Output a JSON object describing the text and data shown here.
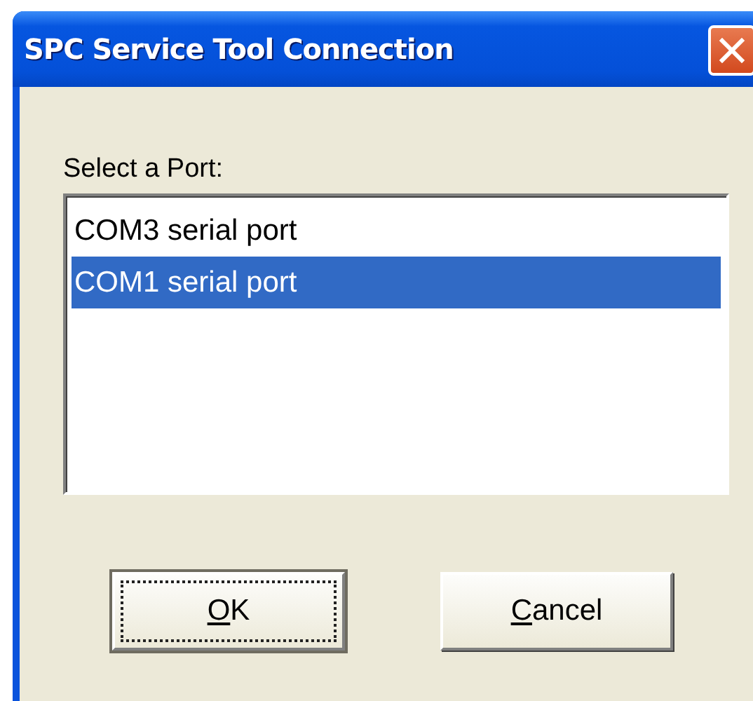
{
  "window": {
    "title": "SPC Service Tool Connection"
  },
  "port_list": {
    "label": "Select a Port:",
    "items": [
      {
        "label": "COM3 serial port",
        "selected": false
      },
      {
        "label": "COM1 serial port",
        "selected": true
      }
    ]
  },
  "buttons": [
    {
      "label": "OK",
      "default": true,
      "mnemonic": true
    },
    {
      "label": "Cancel",
      "default": false,
      "mnemonic": true
    }
  ]
}
